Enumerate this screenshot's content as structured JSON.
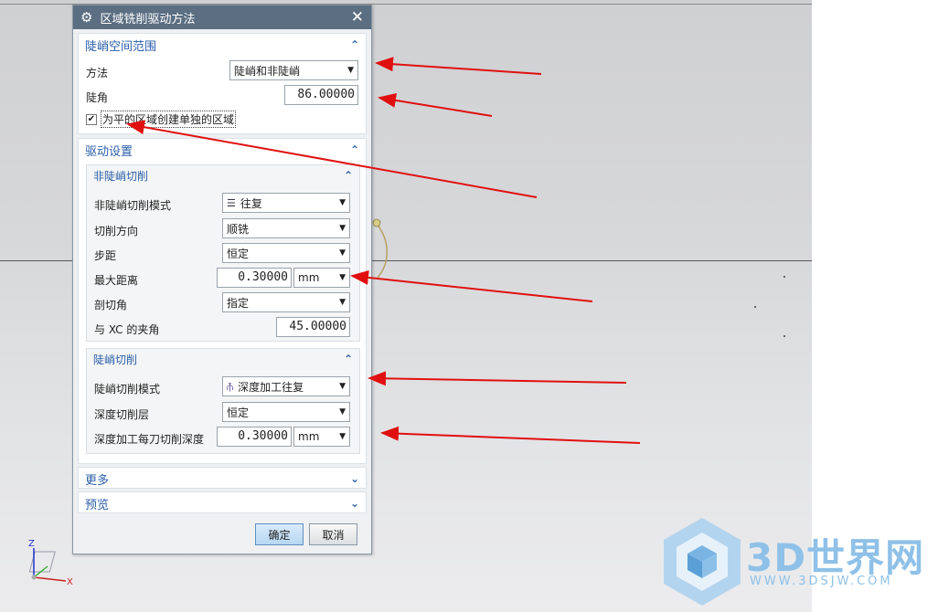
{
  "dialog": {
    "title": "区域铣削驱动方法",
    "steep_space": {
      "header": "陡峭空间范围",
      "method_label": "方法",
      "method_value": "陡峭和非陡峭",
      "angle_label": "陡角",
      "angle_value": "86.00000",
      "checkbox_label": "为平的区域创建单独的区域",
      "checkbox_checked": true
    },
    "drive_settings": {
      "header": "驱动设置",
      "non_steep": {
        "header": "非陡峭切削",
        "mode_label": "非陡峭切削模式",
        "mode_value": "往复",
        "direction_label": "切削方向",
        "direction_value": "顺铣",
        "stepover_label": "步距",
        "stepover_value": "恒定",
        "max_distance_label": "最大距离",
        "max_distance_value": "0.30000",
        "max_distance_unit": "mm",
        "cut_angle_label": "剖切角",
        "cut_angle_value": "指定",
        "xc_angle_label": "与 XC 的夹角",
        "xc_angle_value": "45.00000"
      },
      "steep": {
        "header": "陡峭切削",
        "mode_label": "陡峭切削模式",
        "mode_value": "深度加工往复",
        "depth_layer_label": "深度切削层",
        "depth_layer_value": "恒定",
        "depth_per_cut_label": "深度加工每刀切削深度",
        "depth_per_cut_value": "0.30000",
        "depth_per_cut_unit": "mm"
      }
    },
    "more_header": "更多",
    "preview_header": "预览",
    "ok_label": "确定",
    "cancel_label": "取消"
  },
  "axis": {
    "z": "Z",
    "x": "X"
  },
  "logo": {
    "brand": "3D世界网",
    "url": "WWW.3DSJW.COM"
  },
  "colors": {
    "title_bar": "#5b6e82",
    "section_header": "#2a5ea8",
    "arrow": "#e01010",
    "logo": "#8fc1e8"
  }
}
